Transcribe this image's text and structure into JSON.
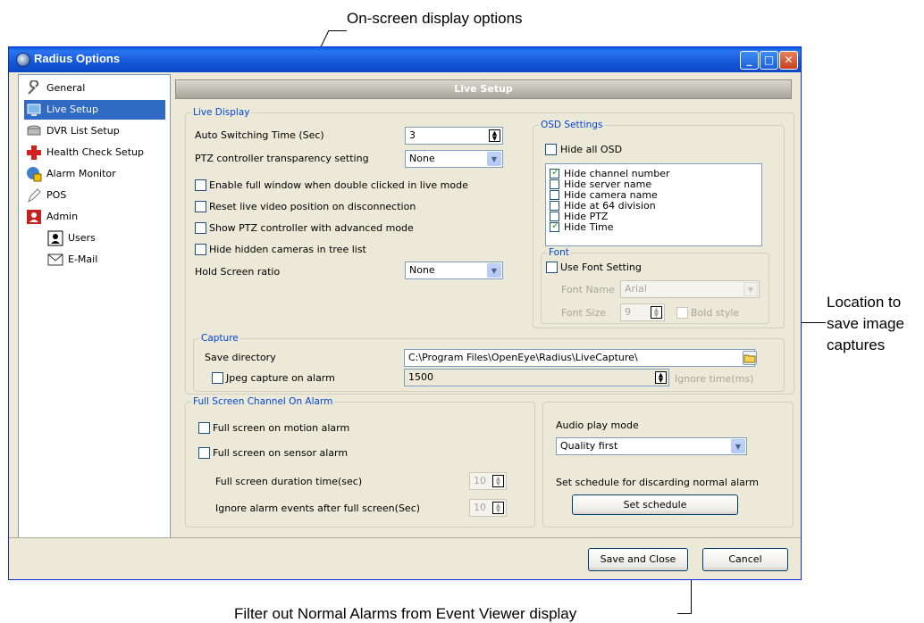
{
  "callouts": {
    "osd": "On-screen display options",
    "capture_line1": "Location to",
    "capture_line2": "save image",
    "capture_line3": "captures",
    "schedule": "Filter out Normal Alarms from Event Viewer display"
  },
  "window": {
    "title": "Radius Options"
  },
  "sidebar": {
    "items": [
      {
        "label": "General",
        "icon": "wrench-icon"
      },
      {
        "label": "Live Setup",
        "icon": "monitor-icon",
        "selected": true
      },
      {
        "label": "DVR List Setup",
        "icon": "dvr-icon"
      },
      {
        "label": "Health Check Setup",
        "icon": "medical-cross-icon"
      },
      {
        "label": "Alarm Monitor",
        "icon": "globe-alarm-icon"
      },
      {
        "label": "POS",
        "icon": "pen-icon"
      },
      {
        "label": "Admin",
        "icon": "admin-icon"
      },
      {
        "label": "Users",
        "icon": "user-icon"
      },
      {
        "label": "E-Mail",
        "icon": "envelope-icon"
      }
    ]
  },
  "header": {
    "title": "Live Setup"
  },
  "live_display": {
    "title": "Live Display",
    "auto_switching_label": "Auto Switching Time (Sec)",
    "auto_switching_value": "3",
    "ptz_transparency_label": "PTZ controller transparency setting",
    "ptz_transparency_value": "None",
    "enable_full_window": "Enable full window when double clicked in live mode",
    "reset_live_video": "Reset live video position on disconnection",
    "show_ptz_advanced": "Show PTZ controller with advanced mode",
    "hide_hidden_cameras": "Hide hidden cameras in tree list",
    "hold_screen_ratio_label": "Hold Screen ratio",
    "hold_screen_ratio_value": "None"
  },
  "osd": {
    "title": "OSD Settings",
    "hide_all": "Hide all OSD",
    "options": [
      {
        "label": "Hide channel number",
        "checked": true
      },
      {
        "label": "Hide server name",
        "checked": false
      },
      {
        "label": "Hide camera name",
        "checked": false
      },
      {
        "label": "Hide at 64 division",
        "checked": false
      },
      {
        "label": "Hide PTZ",
        "checked": false
      },
      {
        "label": "Hide Time",
        "checked": true
      }
    ],
    "font": {
      "title": "Font",
      "use_font_setting": "Use Font Setting",
      "font_name_label": "Font Name",
      "font_name_value": "Arial",
      "font_size_label": "Font Size",
      "font_size_value": "9",
      "bold_style": "Bold style"
    }
  },
  "capture": {
    "title": "Capture",
    "save_directory_label": "Save directory",
    "save_directory_value": "C:\\Program Files\\OpenEye\\Radius\\LiveCapture\\",
    "jpeg_capture_label": "Jpeg capture on alarm",
    "jpeg_capture_value": "1500",
    "ignore_time_label": "Ignore time(ms)"
  },
  "full_screen": {
    "title": "Full Screen Channel On Alarm",
    "on_motion": "Full screen on motion alarm",
    "on_sensor": "Full screen on sensor alarm",
    "duration_label": "Full screen duration time(sec)",
    "duration_value": "10",
    "ignore_events_label": "Ignore alarm events after full screen(Sec)",
    "ignore_events_value": "10"
  },
  "audio": {
    "play_mode_label": "Audio play mode",
    "play_mode_value": "Quality first",
    "schedule_label": "Set schedule for discarding normal alarm",
    "set_schedule_button": "Set schedule"
  },
  "footer": {
    "save_close": "Save and Close",
    "cancel": "Cancel"
  }
}
